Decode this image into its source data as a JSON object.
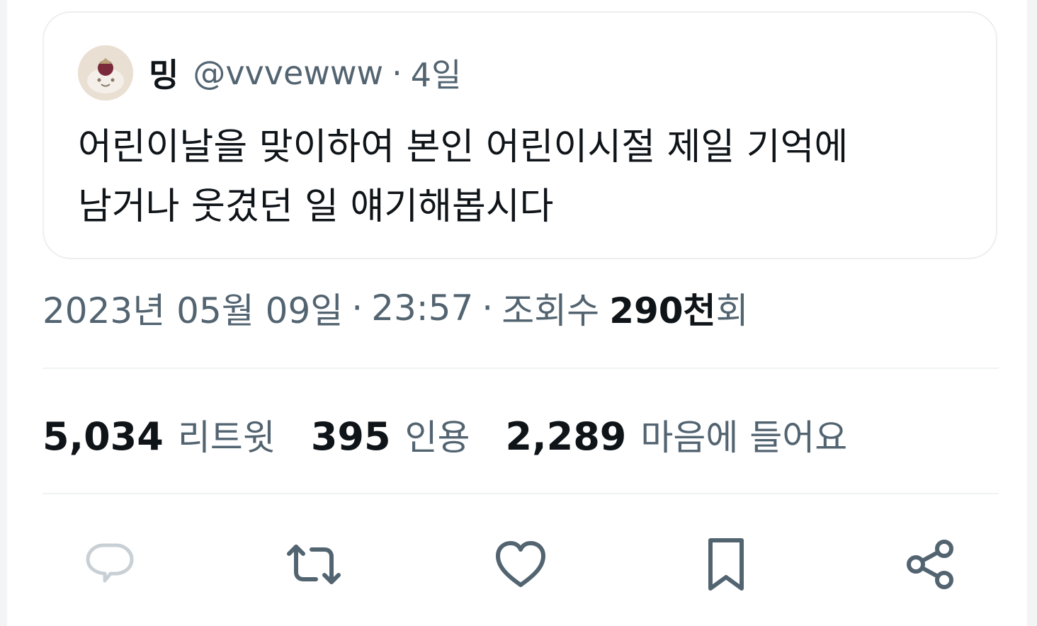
{
  "quoted_tweet": {
    "author_name": "밍",
    "author_handle": "@vvvewww",
    "separator": "·",
    "age": "4일",
    "text": "어린이날을 맞이하여 본인 어린이시절 제일 기억에\n남거나 웃겼던 일 얘기해봅시다"
  },
  "meta": {
    "date": "2023년 05월 09일",
    "separator": "·",
    "time": "23:57",
    "views_label": "조회수",
    "views_count": "290천",
    "views_suffix": "회"
  },
  "stats": {
    "retweets_count": "5,034",
    "retweets_label": "리트윗",
    "quotes_count": "395",
    "quotes_label": "인용",
    "likes_count": "2,289",
    "likes_label": "마음에 들어요"
  },
  "actions": [
    {
      "icon": "reply-icon"
    },
    {
      "icon": "retweet-icon"
    },
    {
      "icon": "heart-icon"
    },
    {
      "icon": "bookmark-icon"
    },
    {
      "icon": "share-icon"
    }
  ],
  "colors": {
    "primary_text": "#0f1419",
    "secondary_text": "#536471",
    "border": "#eceef0",
    "divider": "#eff3f4"
  }
}
